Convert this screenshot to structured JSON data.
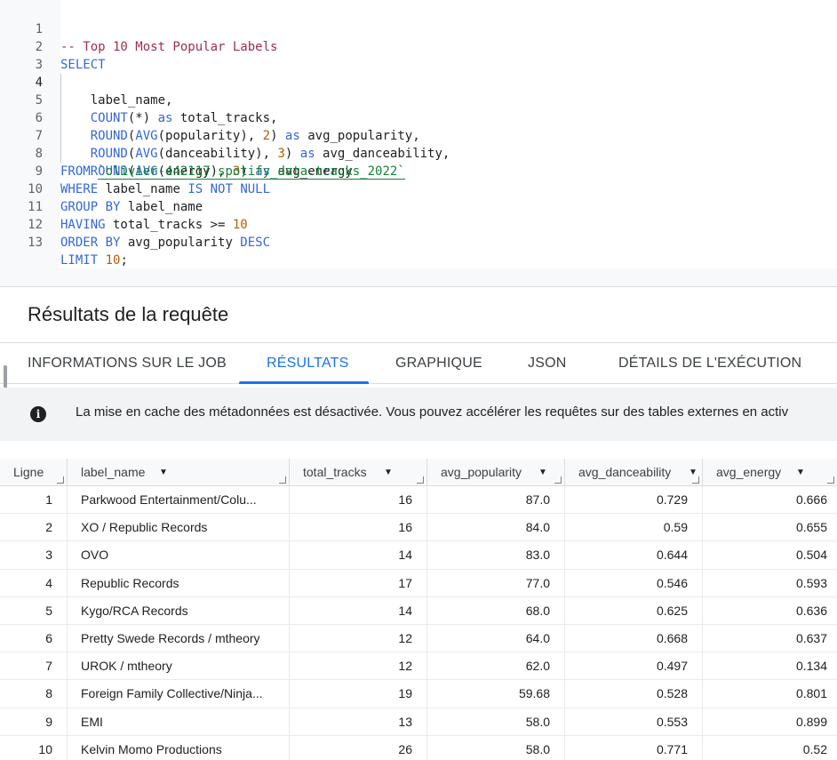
{
  "editor": {
    "lines": [
      {
        "n": "1"
      },
      {
        "n": "2"
      },
      {
        "n": "3"
      },
      {
        "n": "4"
      },
      {
        "n": "5"
      },
      {
        "n": "6"
      },
      {
        "n": "7"
      },
      {
        "n": "8"
      },
      {
        "n": "9"
      },
      {
        "n": "10"
      },
      {
        "n": "11"
      },
      {
        "n": "12"
      },
      {
        "n": "13"
      }
    ],
    "tokens": {
      "l1": "-- Top 10 Most Popular Labels",
      "l2": "SELECT",
      "l3": "    label_name,",
      "l4_fn": "COUNT",
      "l4_rest": "(*) ",
      "l4_as": "as",
      "l4_id": " total_tracks,",
      "l5_fn1": "ROUND",
      "l5_p1": "(",
      "l5_fn2": "AVG",
      "l5_p2": "(popularity), ",
      "l5_num": "2",
      "l5_p3": ") ",
      "l5_as": "as",
      "l5_id": " avg_popularity,",
      "l6_fn1": "ROUND",
      "l6_p1": "(",
      "l6_fn2": "AVG",
      "l6_p2": "(danceability), ",
      "l6_num": "3",
      "l6_p3": ") ",
      "l6_as": "as",
      "l6_id": " avg_danceability,",
      "l7_fn1": "ROUND",
      "l7_p1": "(",
      "l7_fn2": "AVG",
      "l7_p2": "(energy), ",
      "l7_num": "3",
      "l7_p3": ") ",
      "l7_as": "as",
      "l7_id": " avg_energy",
      "l8_kw": "FROM",
      "l8_str": "`olivier-442117.spotify_data.tracks_2022`",
      "l9_kw1": "WHERE",
      "l9_id": " label_name ",
      "l9_kw2": "IS NOT NULL",
      "l10_kw": "GROUP BY",
      "l10_id": " label_name",
      "l11_kw": "HAVING",
      "l11_id": " total_tracks >= ",
      "l11_num": "10",
      "l12_kw1": "ORDER BY",
      "l12_id": " avg_popularity ",
      "l12_kw2": "DESC",
      "l13_kw": "LIMIT",
      "l13_num": "10",
      "l13_end": ";"
    }
  },
  "results": {
    "title": "Résultats de la requête",
    "tabs": [
      {
        "label": "INFORMATIONS SUR LE JOB"
      },
      {
        "label": "RÉSULTATS"
      },
      {
        "label": "GRAPHIQUE"
      },
      {
        "label": "JSON"
      },
      {
        "label": "DÉTAILS DE L'EXÉCUTION"
      }
    ],
    "active_tab": "RÉSULTATS",
    "banner": "La mise en cache des métadonnées est désactivée. Vous pouvez accélérer les requêtes sur des tables externes en activ",
    "info_icon": "i",
    "columns": [
      "Ligne",
      "label_name",
      "total_tracks",
      "avg_popularity",
      "avg_danceability",
      "avg_energy"
    ],
    "sort_arrow": "▼",
    "rows": [
      [
        "1",
        "Parkwood Entertainment/Colu...",
        "16",
        "87.0",
        "0.729",
        "0.666"
      ],
      [
        "2",
        "XO / Republic Records",
        "16",
        "84.0",
        "0.59",
        "0.655"
      ],
      [
        "3",
        "OVO",
        "14",
        "83.0",
        "0.644",
        "0.504"
      ],
      [
        "4",
        "Republic Records",
        "17",
        "77.0",
        "0.546",
        "0.593"
      ],
      [
        "5",
        "Kygo/RCA Records",
        "14",
        "68.0",
        "0.625",
        "0.636"
      ],
      [
        "6",
        "Pretty Swede Records / mtheory",
        "12",
        "64.0",
        "0.668",
        "0.637"
      ],
      [
        "7",
        "UROK / mtheory",
        "12",
        "62.0",
        "0.497",
        "0.134"
      ],
      [
        "8",
        "Foreign Family Collective/Ninja...",
        "19",
        "59.68",
        "0.528",
        "0.801"
      ],
      [
        "9",
        "EMI",
        "13",
        "58.0",
        "0.553",
        "0.899"
      ],
      [
        "10",
        "Kelvin Momo Productions",
        "26",
        "58.0",
        "0.771",
        "0.52"
      ]
    ]
  },
  "colors": {
    "accent": "#1a73e8",
    "keyword": "#3367d6",
    "comment": "#9c2f4a",
    "number": "#b06000",
    "string": "#188038"
  }
}
